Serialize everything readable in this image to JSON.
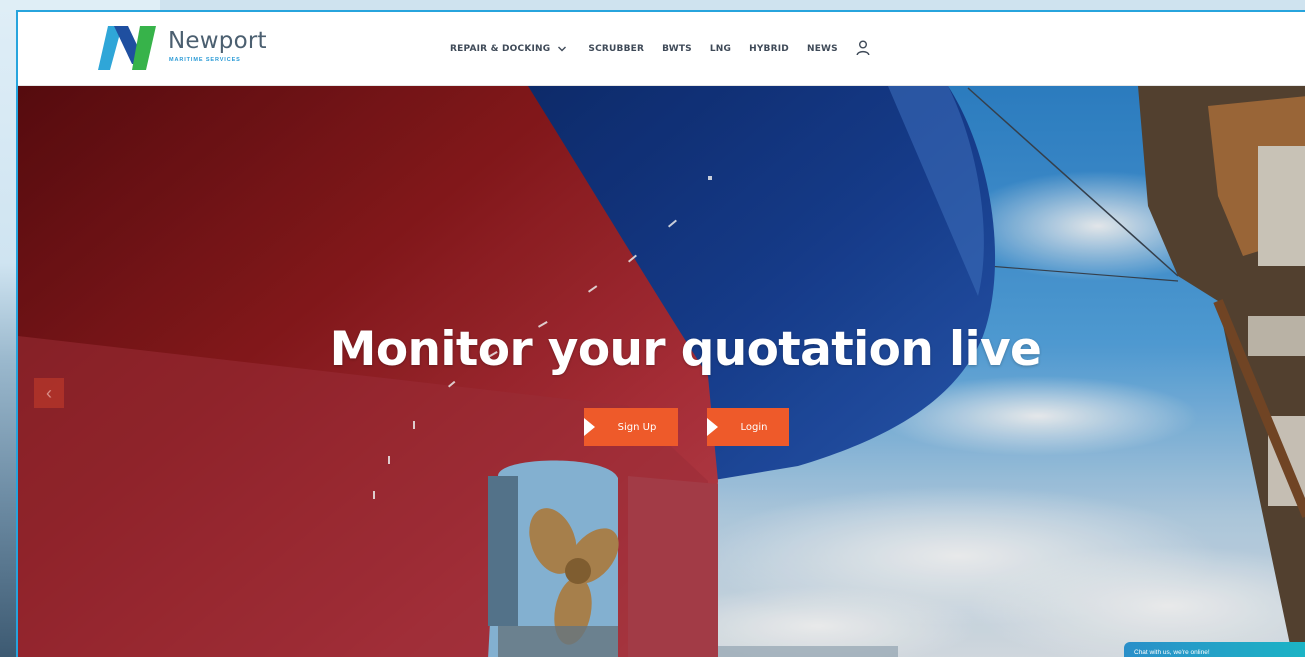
{
  "brand": {
    "name": "Newport",
    "tagline": "MARITIME SERVICES",
    "colors": {
      "green": "#37b34a",
      "blue": "#1f4fa0",
      "teal": "#27a4dd"
    }
  },
  "nav": {
    "items": [
      {
        "label": "REPAIR & DOCKING",
        "has_dropdown": true,
        "icon": "chevron-down-icon"
      },
      {
        "label": "SCRUBBER"
      },
      {
        "label": "BWTS"
      },
      {
        "label": "LNG"
      },
      {
        "label": "HYBRID"
      },
      {
        "label": "NEWS"
      }
    ],
    "account_icon": "user-icon"
  },
  "hero": {
    "headline": "Monitor your quotation live",
    "buttons": {
      "signup": "Sign Up",
      "login": "Login"
    },
    "button_color": "#ee5a2a",
    "prev_icon": "‹"
  },
  "chat": {
    "label": "Chat with us, we're online!"
  }
}
